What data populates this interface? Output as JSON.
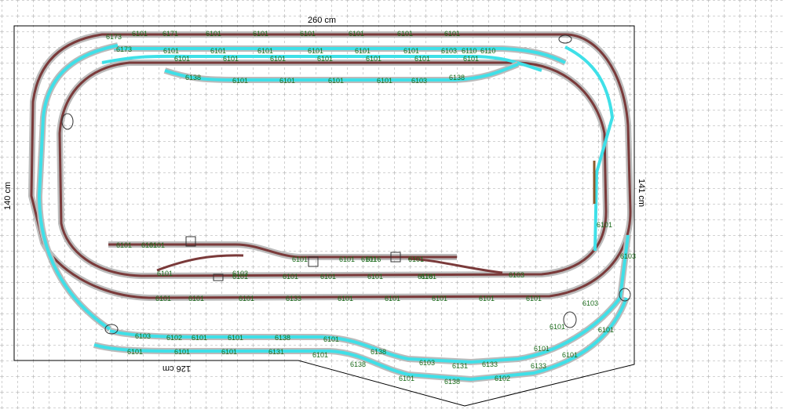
{
  "dimensions": {
    "top": "260 cm",
    "left": "140 cm",
    "right": "141 cm",
    "bottom": "126 cm"
  },
  "colors": {
    "cyan_track": "#3fe0e8",
    "brown_track": "#7a3a3a",
    "grid": "#8a8a8a",
    "label": "#1a6b1a"
  },
  "track_labels": [
    {
      "id": "t01",
      "text": "6173"
    },
    {
      "id": "t02",
      "text": "6101"
    },
    {
      "id": "t03",
      "text": "6171"
    },
    {
      "id": "t04",
      "text": "6101"
    },
    {
      "id": "t05",
      "text": "6101"
    },
    {
      "id": "t06",
      "text": "6101"
    },
    {
      "id": "t07",
      "text": "6101"
    },
    {
      "id": "t08",
      "text": "6101"
    },
    {
      "id": "t09",
      "text": "6101"
    },
    {
      "id": "t10",
      "text": "6173"
    },
    {
      "id": "t11",
      "text": "6101"
    },
    {
      "id": "t12",
      "text": "6101"
    },
    {
      "id": "t13",
      "text": "6101"
    },
    {
      "id": "t14",
      "text": "6101"
    },
    {
      "id": "t15",
      "text": "6101"
    },
    {
      "id": "t16",
      "text": "6101"
    },
    {
      "id": "t17",
      "text": "6103"
    },
    {
      "id": "t18",
      "text": "6110"
    },
    {
      "id": "t19",
      "text": "6110"
    },
    {
      "id": "t20",
      "text": "6101"
    },
    {
      "id": "t21",
      "text": "6101"
    },
    {
      "id": "t22",
      "text": "6101"
    },
    {
      "id": "t23",
      "text": "6101"
    },
    {
      "id": "t24",
      "text": "6101"
    },
    {
      "id": "t25",
      "text": "6101"
    },
    {
      "id": "t26",
      "text": "6101"
    },
    {
      "id": "t27",
      "text": "6138"
    },
    {
      "id": "t28",
      "text": "6101"
    },
    {
      "id": "t29",
      "text": "6101"
    },
    {
      "id": "t30",
      "text": "6101"
    },
    {
      "id": "t31",
      "text": "6101"
    },
    {
      "id": "t32",
      "text": "6103"
    },
    {
      "id": "t33",
      "text": "6138"
    },
    {
      "id": "t34",
      "text": "6101"
    },
    {
      "id": "t35",
      "text": "6101"
    },
    {
      "id": "t36",
      "text": "6101"
    },
    {
      "id": "t37",
      "text": "6101"
    },
    {
      "id": "t38",
      "text": "6101"
    },
    {
      "id": "t39",
      "text": "6101"
    },
    {
      "id": "t40",
      "text": "6101"
    },
    {
      "id": "t41",
      "text": "6101"
    },
    {
      "id": "t42",
      "text": "6101"
    },
    {
      "id": "t43",
      "text": "6133"
    },
    {
      "id": "t44",
      "text": "6103"
    },
    {
      "id": "t45",
      "text": "6102"
    },
    {
      "id": "t46",
      "text": "6101"
    },
    {
      "id": "t47",
      "text": "6101"
    },
    {
      "id": "t48",
      "text": "6138"
    },
    {
      "id": "t49",
      "text": "6101"
    },
    {
      "id": "t50",
      "text": "6138"
    },
    {
      "id": "t51",
      "text": "6103"
    },
    {
      "id": "t52",
      "text": "6131"
    },
    {
      "id": "t53",
      "text": "6133"
    },
    {
      "id": "t54",
      "text": "6101"
    },
    {
      "id": "t55",
      "text": "6101"
    },
    {
      "id": "t56",
      "text": "6101"
    },
    {
      "id": "t57",
      "text": "6131"
    },
    {
      "id": "t58",
      "text": "6101"
    },
    {
      "id": "t59",
      "text": "6138"
    },
    {
      "id": "t60",
      "text": "6101"
    },
    {
      "id": "t61",
      "text": "6138"
    },
    {
      "id": "t62",
      "text": "6102"
    },
    {
      "id": "t63",
      "text": "6133"
    },
    {
      "id": "t64",
      "text": "6101"
    },
    {
      "id": "t65",
      "text": "6101"
    },
    {
      "id": "t66",
      "text": "6101"
    },
    {
      "id": "t67",
      "text": "6101"
    },
    {
      "id": "t68",
      "text": "6103"
    },
    {
      "id": "t69",
      "text": "6101"
    },
    {
      "id": "t70",
      "text": "6103"
    },
    {
      "id": "t71",
      "text": "6101"
    },
    {
      "id": "t72",
      "text": "6101"
    },
    {
      "id": "t73",
      "text": "6101"
    },
    {
      "id": "t74",
      "text": "6101"
    },
    {
      "id": "t75",
      "text": "6101"
    },
    {
      "id": "t76",
      "text": "6101"
    },
    {
      "id": "t77",
      "text": "6101"
    },
    {
      "id": "t78",
      "text": "6103"
    },
    {
      "id": "t79",
      "text": "6101"
    },
    {
      "id": "t80",
      "text": "6118"
    },
    {
      "id": "t81",
      "text": "6101"
    },
    {
      "id": "t82",
      "text": "6103"
    },
    {
      "id": "t83",
      "text": "6116"
    },
    {
      "id": "t84",
      "text": "6101"
    },
    {
      "id": "t85",
      "text": "6101"
    },
    {
      "id": "t86",
      "text": "6101"
    }
  ]
}
